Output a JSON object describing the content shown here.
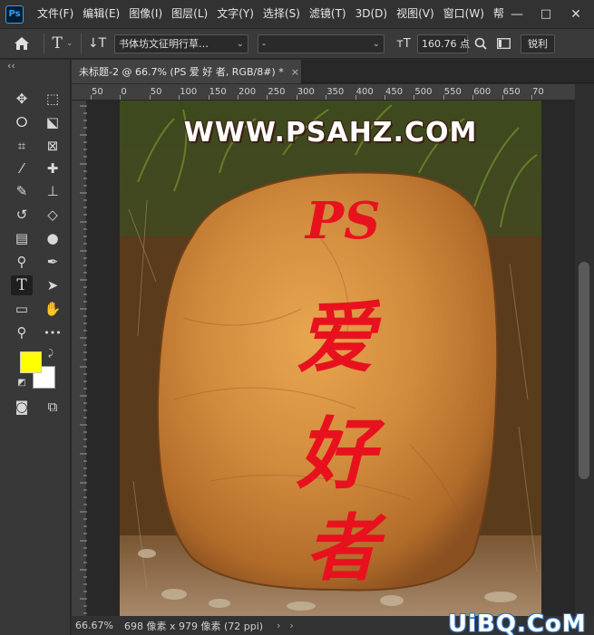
{
  "app": {
    "logo": "Ps"
  },
  "menu": [
    "文件(F)",
    "编辑(E)",
    "图像(I)",
    "图层(L)",
    "文字(Y)",
    "选择(S)",
    "滤镜(T)",
    "3D(D)",
    "视图(V)",
    "窗口(W)",
    "帮"
  ],
  "window": {
    "minimize": "—",
    "maximize": "□",
    "close": "✕"
  },
  "options": {
    "font_family": "书体坊文征明行草…",
    "font_style": "-",
    "font_size": "160.76 点",
    "antialias": "锐利"
  },
  "toolbar": {
    "collapse": "‹‹"
  },
  "tools": [
    {
      "name": "move-tool",
      "icon": "✥"
    },
    {
      "name": "marquee-tool",
      "icon": "⬚"
    },
    {
      "name": "lasso-tool",
      "icon": "ⵔ"
    },
    {
      "name": "quick-select-tool",
      "icon": "⬕"
    },
    {
      "name": "crop-tool",
      "icon": "⌗"
    },
    {
      "name": "frame-tool",
      "icon": "⊠"
    },
    {
      "name": "eyedropper-tool",
      "icon": "⁄"
    },
    {
      "name": "healing-tool",
      "icon": "✚"
    },
    {
      "name": "brush-tool",
      "icon": "✎"
    },
    {
      "name": "stamp-tool",
      "icon": "⊥"
    },
    {
      "name": "history-brush-tool",
      "icon": "↺"
    },
    {
      "name": "eraser-tool",
      "icon": "◇"
    },
    {
      "name": "gradient-tool",
      "icon": "▤"
    },
    {
      "name": "blur-tool",
      "icon": "●"
    },
    {
      "name": "dodge-tool",
      "icon": "⚲"
    },
    {
      "name": "pen-tool",
      "icon": "✒"
    },
    {
      "name": "type-tool",
      "icon": "T"
    },
    {
      "name": "path-select-tool",
      "icon": "➤"
    },
    {
      "name": "shape-tool",
      "icon": "▭"
    },
    {
      "name": "hand-tool",
      "icon": "✋"
    },
    {
      "name": "zoom-tool",
      "icon": "⚲"
    },
    {
      "name": "more-tools",
      "icon": "•••"
    },
    {
      "name": "quick-mask",
      "icon": "◙"
    },
    {
      "name": "screen-mode",
      "icon": "⧉"
    }
  ],
  "colors": {
    "foreground": "#ffff00",
    "background": "#ffffff"
  },
  "document": {
    "tab_title": "未标题-2 @ 66.7% (PS 爱 好 者, RGB/8#) *",
    "close": "×"
  },
  "ruler": {
    "labels": [
      "50",
      "0",
      "50",
      "100",
      "150",
      "200",
      "250",
      "300",
      "350",
      "400",
      "450",
      "500",
      "550",
      "600",
      "650",
      "70"
    ]
  },
  "canvas": {
    "site_title": "WWW.PSAHZ.COM",
    "line1": "PS",
    "line2": "爱",
    "line3": "好",
    "line4": "者"
  },
  "status": {
    "zoom": "66.67%",
    "info": "698 像素 x 979 像素 (72 ppi)",
    "arrow": "›"
  },
  "watermark": "UiBQ.CoM"
}
